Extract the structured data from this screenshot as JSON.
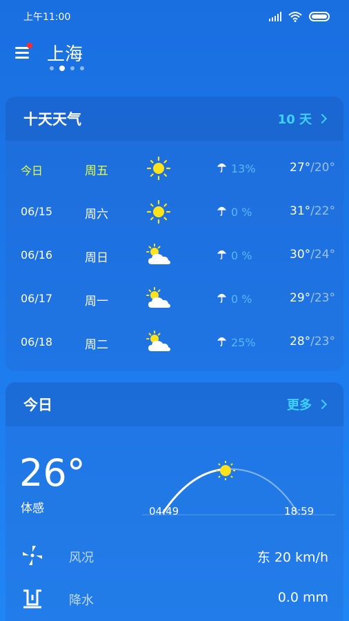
{
  "status": {
    "time": "上午11:00"
  },
  "header": {
    "city": "上海"
  },
  "ten_day": {
    "title": "十天天气",
    "more_label": "10 天",
    "rows": [
      {
        "date": "今日",
        "weekday": "周五",
        "icon": "sunny-icon",
        "rain": "13%",
        "high": "27°",
        "low": "/20°"
      },
      {
        "date": "06/15",
        "weekday": "周六",
        "icon": "sunny-icon",
        "rain": "0 %",
        "high": "31°",
        "low": "/22°"
      },
      {
        "date": "06/16",
        "weekday": "周日",
        "icon": "partly-cloudy-icon",
        "rain": "0 %",
        "high": "30°",
        "low": "/24°"
      },
      {
        "date": "06/17",
        "weekday": "周一",
        "icon": "partly-cloudy-icon",
        "rain": "0 %",
        "high": "29°",
        "low": "/23°"
      },
      {
        "date": "06/18",
        "weekday": "周二",
        "icon": "partly-cloudy-icon",
        "rain": "25%",
        "high": "28°",
        "low": "/23°"
      }
    ]
  },
  "today": {
    "title": "今日",
    "more_label": "更多",
    "temperature": "26°",
    "feel_label": "体感",
    "sunrise": "04:49",
    "sunset": "18:59",
    "wind": {
      "label": "风况",
      "value": "东 20 km/h",
      "icon": "wind-icon"
    },
    "precip": {
      "label": "降水",
      "value": "0.0 mm",
      "icon": "precipitation-icon"
    }
  },
  "colors": {
    "accent": "#3fd0ff",
    "today_highlight": "#e7ff4a",
    "rain": "#58b8ff",
    "sun": "#ffe31a"
  }
}
